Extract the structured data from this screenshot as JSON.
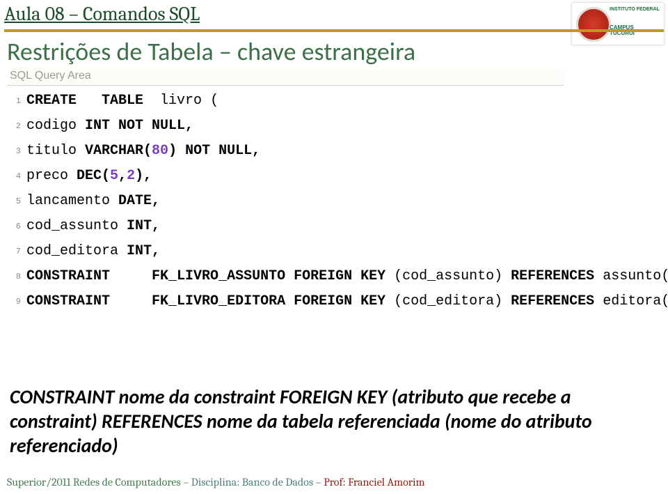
{
  "header": {
    "lesson": "Aula 08 – Comandos SQL",
    "subtitle": "Restrições de Tabela – chave estrangeira"
  },
  "logo": {
    "line1": "INSTITUTO FEDERAL",
    "campus_label": "CAMPUS",
    "campus_name": "TUCURUÍ"
  },
  "sql_label": "SQL Query Area",
  "code": {
    "lines": [
      {
        "n": "1",
        "tokens": [
          {
            "t": "CREATE",
            "c": "kw"
          },
          {
            "t": "   "
          },
          {
            "t": "TABLE",
            "c": "kw"
          },
          {
            "t": "  livro ("
          }
        ]
      },
      {
        "n": "2",
        "tokens": [
          {
            "t": "codigo "
          },
          {
            "t": "INT NOT NULL,",
            "c": "kw"
          }
        ]
      },
      {
        "n": "3",
        "tokens": [
          {
            "t": "titulo "
          },
          {
            "t": "VARCHAR",
            "c": "kw"
          },
          {
            "t": "(",
            "c": "kw"
          },
          {
            "t": "80",
            "c": "num"
          },
          {
            "t": ")",
            "c": "kw"
          },
          {
            "t": " "
          },
          {
            "t": "NOT NULL,",
            "c": "kw"
          }
        ]
      },
      {
        "n": "4",
        "tokens": [
          {
            "t": "preco "
          },
          {
            "t": "DEC",
            "c": "kw"
          },
          {
            "t": "(",
            "c": "kw"
          },
          {
            "t": "5",
            "c": "num"
          },
          {
            "t": ",",
            "c": "kw"
          },
          {
            "t": "2",
            "c": "num"
          },
          {
            "t": "),",
            "c": "kw"
          }
        ]
      },
      {
        "n": "5",
        "tokens": [
          {
            "t": "lancamento "
          },
          {
            "t": "DATE,",
            "c": "kw"
          }
        ]
      },
      {
        "n": "6",
        "tokens": [
          {
            "t": "cod_assunto "
          },
          {
            "t": "INT,",
            "c": "kw"
          }
        ]
      },
      {
        "n": "7",
        "tokens": [
          {
            "t": "cod_editora "
          },
          {
            "t": "INT,",
            "c": "kw"
          }
        ]
      },
      {
        "n": "8",
        "tokens": [
          {
            "t": "CONSTRAINT",
            "c": "kw"
          },
          {
            "t": "     "
          },
          {
            "t": "FK_LIVRO_ASSUNTO",
            "c": "kw"
          },
          {
            "t": " "
          },
          {
            "t": "FOREIGN KEY",
            "c": "kw"
          },
          {
            "t": " (cod_assunto) "
          },
          {
            "t": "REFERENCES",
            "c": "kw"
          },
          {
            "t": " assunto(codigo),"
          }
        ]
      },
      {
        "n": "9",
        "tokens": [
          {
            "t": "CONSTRAINT",
            "c": "kw"
          },
          {
            "t": "     "
          },
          {
            "t": "FK_LIVRO_EDITORA",
            "c": "kw"
          },
          {
            "t": " "
          },
          {
            "t": "FOREIGN KEY",
            "c": "kw"
          },
          {
            "t": " (cod_editora) "
          },
          {
            "t": "REFERENCES",
            "c": "kw"
          },
          {
            "t": " editora(codigo));"
          }
        ]
      }
    ]
  },
  "explanation": {
    "text": "CONSTRAINT nome da constraint FOREIGN KEY (atributo que recebe a constraint) REFERENCES nome da tabela referenciada (nome do atributo referenciado)"
  },
  "footer": {
    "left": "Superior/2011 Redes de Computadores",
    "dash1": " – ",
    "mid": "Disciplina: Banco de Dados",
    "dash2": " – ",
    "right": "Prof: Franciel Amorim"
  }
}
